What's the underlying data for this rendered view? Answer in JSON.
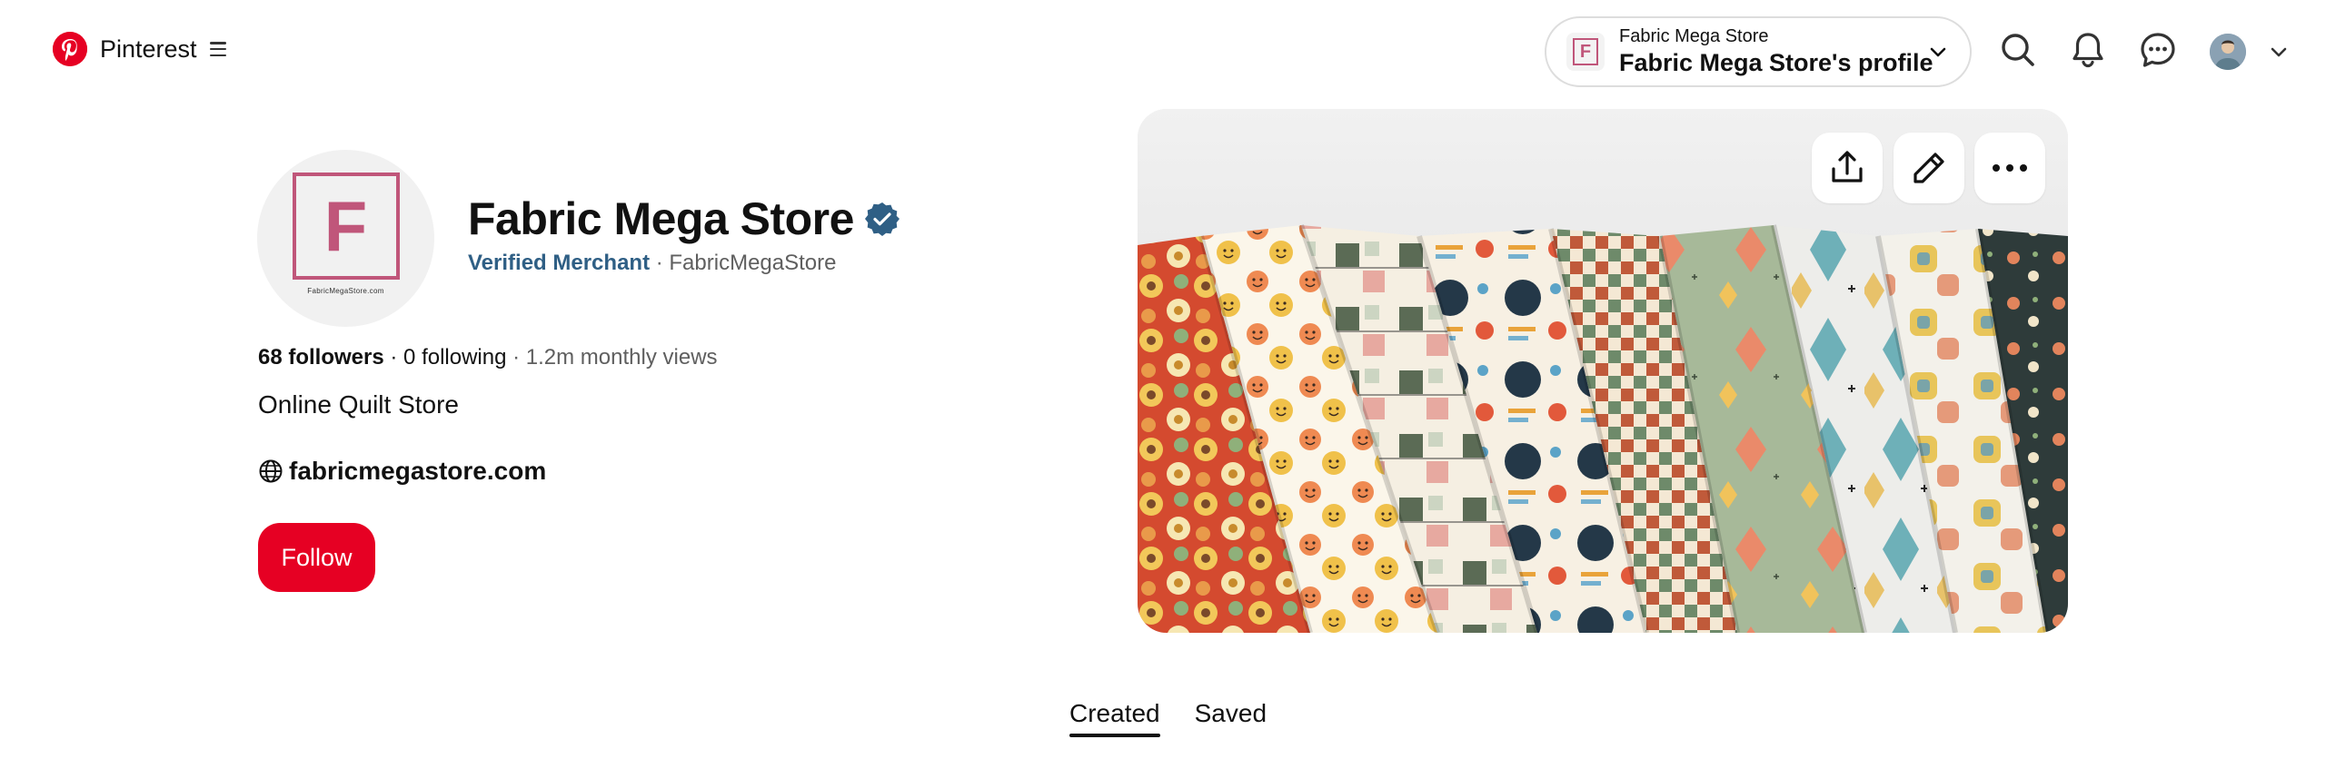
{
  "header": {
    "brand": "Pinterest",
    "account_switcher": {
      "small_label": "Fabric Mega Store",
      "profile_label": "Fabric Mega Store's profile",
      "thumb_letter": "F"
    },
    "icons": [
      "search-icon",
      "notifications-icon",
      "messages-icon",
      "avatar",
      "chevron-down-icon"
    ]
  },
  "profile": {
    "avatar_letter": "F",
    "avatar_caption": "FabricMegaStore.com",
    "name": "Fabric Mega Store",
    "verified_label": "Verified Merchant",
    "separator": " · ",
    "username": "FabricMegaStore",
    "followers": "68 followers",
    "following": "0 following",
    "monthly_views": "1.2m monthly views",
    "bio": "Online Quilt Store",
    "website": "fabricmegastore.com",
    "follow_label": "Follow"
  },
  "cover": {
    "description_icons": [
      "share-icon",
      "edit-icon",
      "more-icon"
    ]
  },
  "tabs": [
    {
      "label": "Created",
      "active": true
    },
    {
      "label": "Saved",
      "active": false
    }
  ],
  "colors": {
    "brand_red": "#e60023",
    "merchant_blue": "#2f5f85",
    "logo_pink": "#c0567a"
  }
}
